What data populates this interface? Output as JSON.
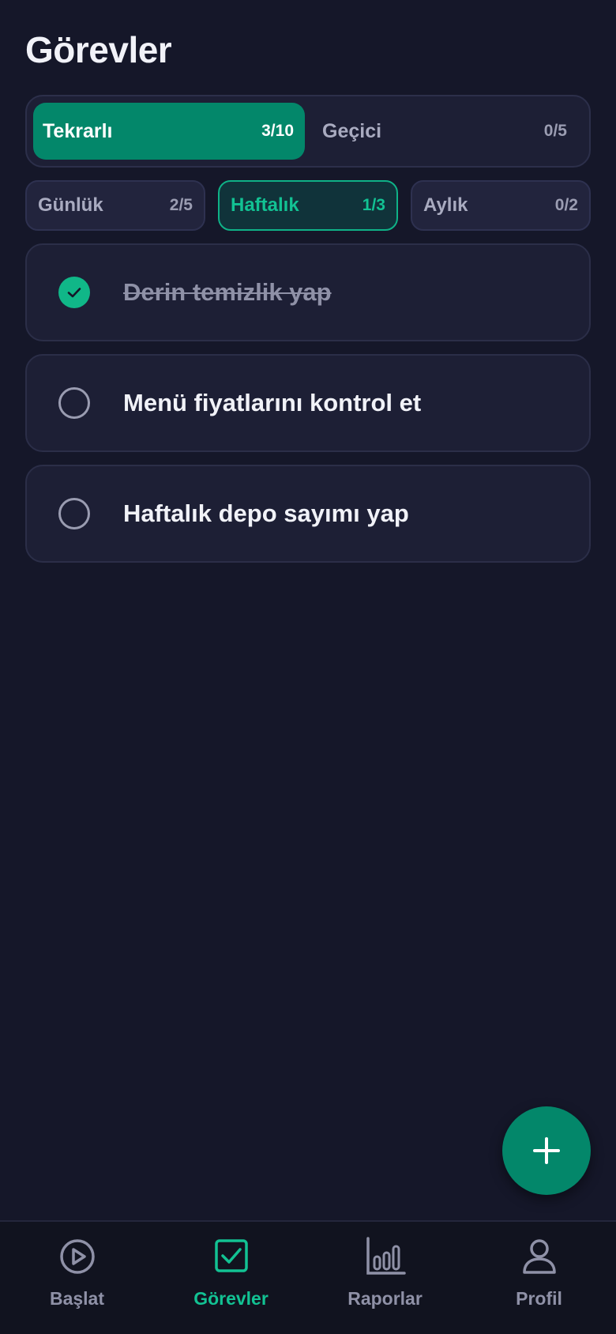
{
  "header": {
    "title": "Görevler"
  },
  "segment": {
    "options": [
      {
        "label": "Tekrarlı",
        "count": "3/10",
        "active": true
      },
      {
        "label": "Geçici",
        "count": "0/5",
        "active": false
      }
    ]
  },
  "periods": [
    {
      "label": "Günlük",
      "count": "2/5",
      "active": false
    },
    {
      "label": "Haftalık",
      "count": "1/3",
      "active": true
    },
    {
      "label": "Aylık",
      "count": "0/2",
      "active": false
    }
  ],
  "tasks": [
    {
      "label": "Derin temizlik yap",
      "done": true
    },
    {
      "label": "Menü fiyatlarını kontrol et",
      "done": false
    },
    {
      "label": "Haftalık depo sayımı yap",
      "done": false
    }
  ],
  "fab": {
    "icon": "plus-icon"
  },
  "bottom_nav": [
    {
      "label": "Başlat",
      "icon": "play-circle-icon",
      "active": false
    },
    {
      "label": "Görevler",
      "icon": "checkbox-icon",
      "active": true
    },
    {
      "label": "Raporlar",
      "icon": "bar-chart-icon",
      "active": false
    },
    {
      "label": "Profil",
      "icon": "user-icon",
      "active": false
    }
  ],
  "colors": {
    "background": "#151729",
    "card": "#1d1f35",
    "accent": "#03876a",
    "accent_bright": "#12c293",
    "muted": "#8f91a7"
  }
}
